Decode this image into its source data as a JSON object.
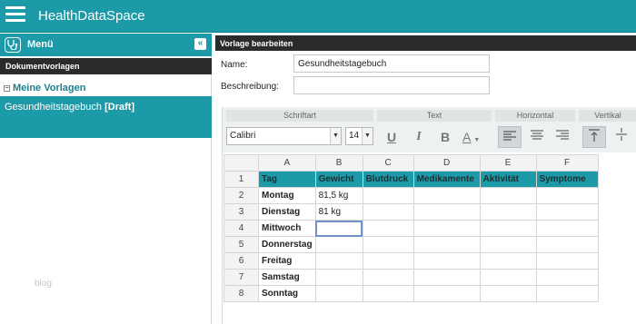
{
  "app": {
    "title": "HealthDataSpace"
  },
  "sidebar": {
    "menu_label": "Menü",
    "collapse_symbol": "«",
    "section_title": "Dokumentvorlagen",
    "tree_toggle": "⊟",
    "group_label": "Meine Vorlagen",
    "template_name": "Gesundheitstagebuch",
    "template_status": "[Draft]",
    "watermark": "blog"
  },
  "main": {
    "header": "Vorlage bearbeiten",
    "name_label": "Name:",
    "name_value": "Gesundheitstagebuch",
    "description_label": "Beschreibung:",
    "description_value": ""
  },
  "ribbon": {
    "groups": [
      "Schriftart",
      "Text",
      "Horizontal",
      "Vertikal"
    ],
    "font_family": "Calibri",
    "font_size": "14",
    "tools": {
      "underline": "U",
      "italic": "I",
      "bold": "B",
      "color": "A"
    }
  },
  "sheet": {
    "columns": [
      "A",
      "B",
      "C",
      "D",
      "E",
      "F"
    ],
    "rows": [
      {
        "num": "1",
        "cells": [
          "Tag",
          "Gewicht",
          "Blutdruck",
          "Medikamente",
          "Aktivität",
          "Symptome"
        ]
      },
      {
        "num": "2",
        "cells": [
          "Montag",
          "81,5 kg",
          "",
          "",
          "",
          ""
        ]
      },
      {
        "num": "3",
        "cells": [
          "Dienstag",
          "81 kg",
          "",
          "",
          "",
          ""
        ]
      },
      {
        "num": "4",
        "cells": [
          "Mittwoch",
          "",
          "",
          "",
          "",
          ""
        ]
      },
      {
        "num": "5",
        "cells": [
          "Donnerstag",
          "",
          "",
          "",
          "",
          ""
        ]
      },
      {
        "num": "6",
        "cells": [
          "Freitag",
          "",
          "",
          "",
          "",
          ""
        ]
      },
      {
        "num": "7",
        "cells": [
          "Samstag",
          "",
          "",
          "",
          "",
          ""
        ]
      },
      {
        "num": "8",
        "cells": [
          "Sonntag",
          "",
          "",
          "",
          "",
          ""
        ]
      }
    ],
    "colors": {
      "header_fill": "#1c9aa8",
      "selection": "#6f93c9"
    }
  }
}
